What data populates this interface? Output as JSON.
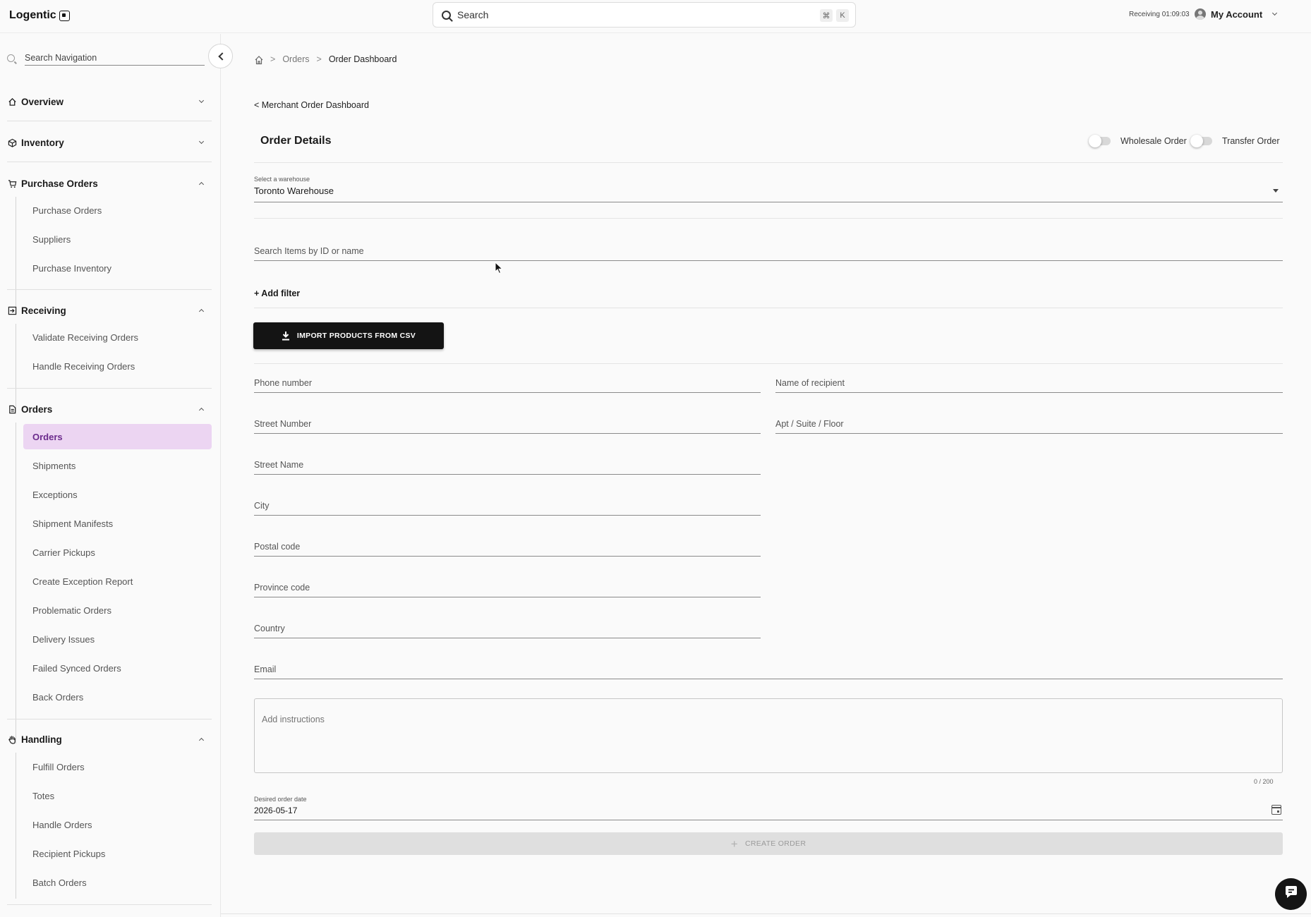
{
  "app": {
    "name": "Logentic"
  },
  "topbar": {
    "search_placeholder": "Search",
    "shortcut_keys": [
      "⌘",
      "K"
    ],
    "receiving_status": "Receiving 01:09:03",
    "account_label": "My Account"
  },
  "sidebar": {
    "search_placeholder": "Search Navigation",
    "sections": [
      {
        "label": "Overview",
        "icon": "home-icon",
        "expanded": false,
        "items": []
      },
      {
        "label": "Inventory",
        "icon": "box-icon",
        "expanded": false,
        "items": []
      },
      {
        "label": "Purchase Orders",
        "icon": "cart-icon",
        "expanded": true,
        "items": [
          "Purchase Orders",
          "Suppliers",
          "Purchase Inventory"
        ]
      },
      {
        "label": "Receiving",
        "icon": "receive-icon",
        "expanded": true,
        "items": [
          "Validate Receiving Orders",
          "Handle Receiving Orders"
        ]
      },
      {
        "label": "Orders",
        "icon": "document-icon",
        "expanded": true,
        "items": [
          "Orders",
          "Shipments",
          "Exceptions",
          "Shipment Manifests",
          "Carrier Pickups",
          "Create Exception Report",
          "Problematic Orders",
          "Delivery Issues",
          "Failed Synced Orders",
          "Back Orders"
        ],
        "active_item": "Orders"
      },
      {
        "label": "Handling",
        "icon": "hand-icon",
        "expanded": true,
        "items": [
          "Fulfill Orders",
          "Totes",
          "Handle Orders",
          "Recipient Pickups",
          "Batch Orders"
        ]
      }
    ]
  },
  "breadcrumb": {
    "items": [
      "Orders",
      "Order Dashboard"
    ]
  },
  "main": {
    "back_link": "< Merchant Order Dashboard",
    "title": "Order Details",
    "toggles": {
      "wholesale": "Wholesale Order",
      "transfer": "Transfer Order"
    },
    "warehouse": {
      "label": "Select a warehouse",
      "value": "Toronto Warehouse"
    },
    "item_search_placeholder": "Search Items by ID or name",
    "add_filter": "+ Add filter",
    "import_button": "IMPORT PRODUCTS FROM CSV",
    "fields": {
      "phone": "Phone number",
      "recipient": "Name of recipient",
      "street_number": "Street Number",
      "apt": "Apt / Suite / Floor",
      "street_name": "Street Name",
      "city": "City",
      "postal": "Postal code",
      "province": "Province code",
      "country": "Country",
      "email": "Email"
    },
    "instructions_placeholder": "Add instructions",
    "instructions_counter": "0 / 200",
    "date": {
      "label": "Desired order date",
      "value": "2026-05-17"
    },
    "create_button": "CREATE ORDER"
  }
}
